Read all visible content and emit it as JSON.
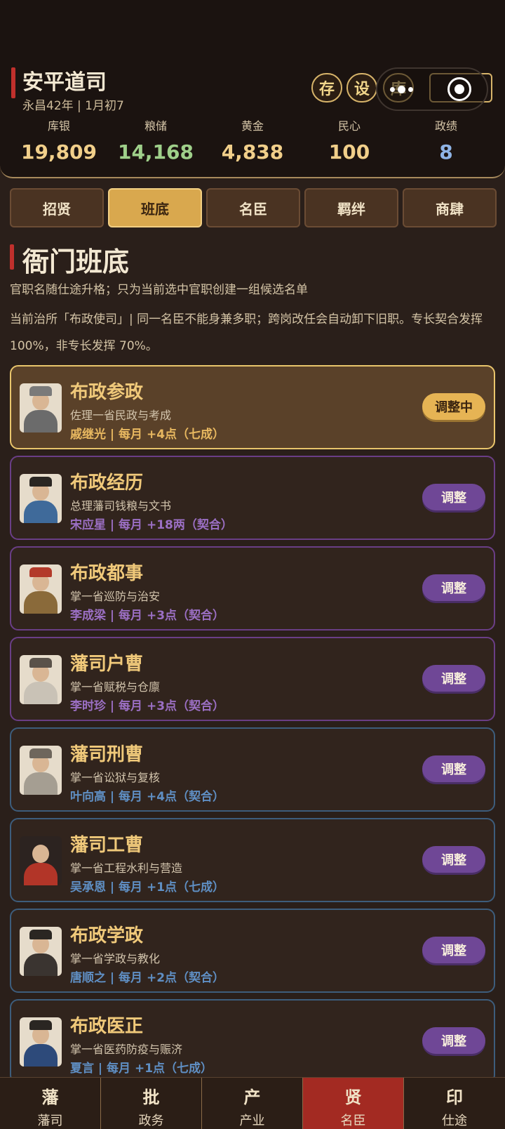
{
  "header": {
    "title": "安平道司",
    "subtitle": "永昌42年 | 1月初7",
    "buttons": [
      "存",
      "设",
      "库"
    ]
  },
  "stats": [
    {
      "label": "库银",
      "value": "19,809",
      "color": "#f1cf8a"
    },
    {
      "label": "粮储",
      "value": "14,168",
      "color": "#9fd08a"
    },
    {
      "label": "黄金",
      "value": "4,838",
      "color": "#f1cf8a"
    },
    {
      "label": "民心",
      "value": "100",
      "color": "#f1cf8a"
    },
    {
      "label": "政绩",
      "value": "8",
      "color": "#8fb4e6"
    }
  ],
  "tabs": [
    "招贤",
    "班底",
    "名臣",
    "羁绊",
    "商肆"
  ],
  "active_tab": 1,
  "section": {
    "title": "衙门班底",
    "note1": "官职名随仕途升格；只为当前选中官职创建一组候选名单",
    "note2": "当前治所「布政使司」| 同一名臣不能身兼多职；跨岗改任会自动卸下旧职。专长契合发挥 100%，非专长发挥 70%。"
  },
  "posts": [
    {
      "title": "布政参政",
      "desc": "佐理一省民政与考成",
      "meta": "戚继光 | 每月 +4点（七成）",
      "button": "调整中",
      "meta_color": "#e8b860"
    },
    {
      "title": "布政经历",
      "desc": "总理藩司钱粮与文书",
      "meta": "宋应星 | 每月 +18两（契合）",
      "button": "调整",
      "meta_color": "#9b6fc4"
    },
    {
      "title": "布政都事",
      "desc": "掌一省巡防与治安",
      "meta": "李成梁 | 每月 +3点（契合）",
      "button": "调整",
      "meta_color": "#9b6fc4"
    },
    {
      "title": "藩司户曹",
      "desc": "掌一省赋税与仓廪",
      "meta": "李时珍 | 每月 +3点（契合）",
      "button": "调整",
      "meta_color": "#9b6fc4"
    },
    {
      "title": "藩司刑曹",
      "desc": "掌一省讼狱与复核",
      "meta": "叶向高 | 每月 +4点（契合）",
      "button": "调整",
      "meta_color": "#5f8fc4"
    },
    {
      "title": "藩司工曹",
      "desc": "掌一省工程水利与营造",
      "meta": "吴承恩 | 每月 +1点（七成）",
      "button": "调整",
      "meta_color": "#5f8fc4"
    },
    {
      "title": "布政学政",
      "desc": "掌一省学政与教化",
      "meta": "唐顺之 | 每月 +2点（契合）",
      "button": "调整",
      "meta_color": "#5f8fc4"
    },
    {
      "title": "布政医正",
      "desc": "掌一省医药防疫与赈济",
      "meta": "夏言 | 每月 +1点（七成）",
      "button": "调整",
      "meta_color": "#5f8fc4"
    }
  ],
  "bottom_nav": [
    {
      "icon_char": "藩",
      "label": "藩司"
    },
    {
      "icon_char": "批",
      "label": "政务"
    },
    {
      "icon_char": "产",
      "label": "产业"
    },
    {
      "icon_char": "贤",
      "label": "名臣"
    },
    {
      "icon_char": "印",
      "label": "仕途"
    }
  ],
  "active_nav": 3
}
